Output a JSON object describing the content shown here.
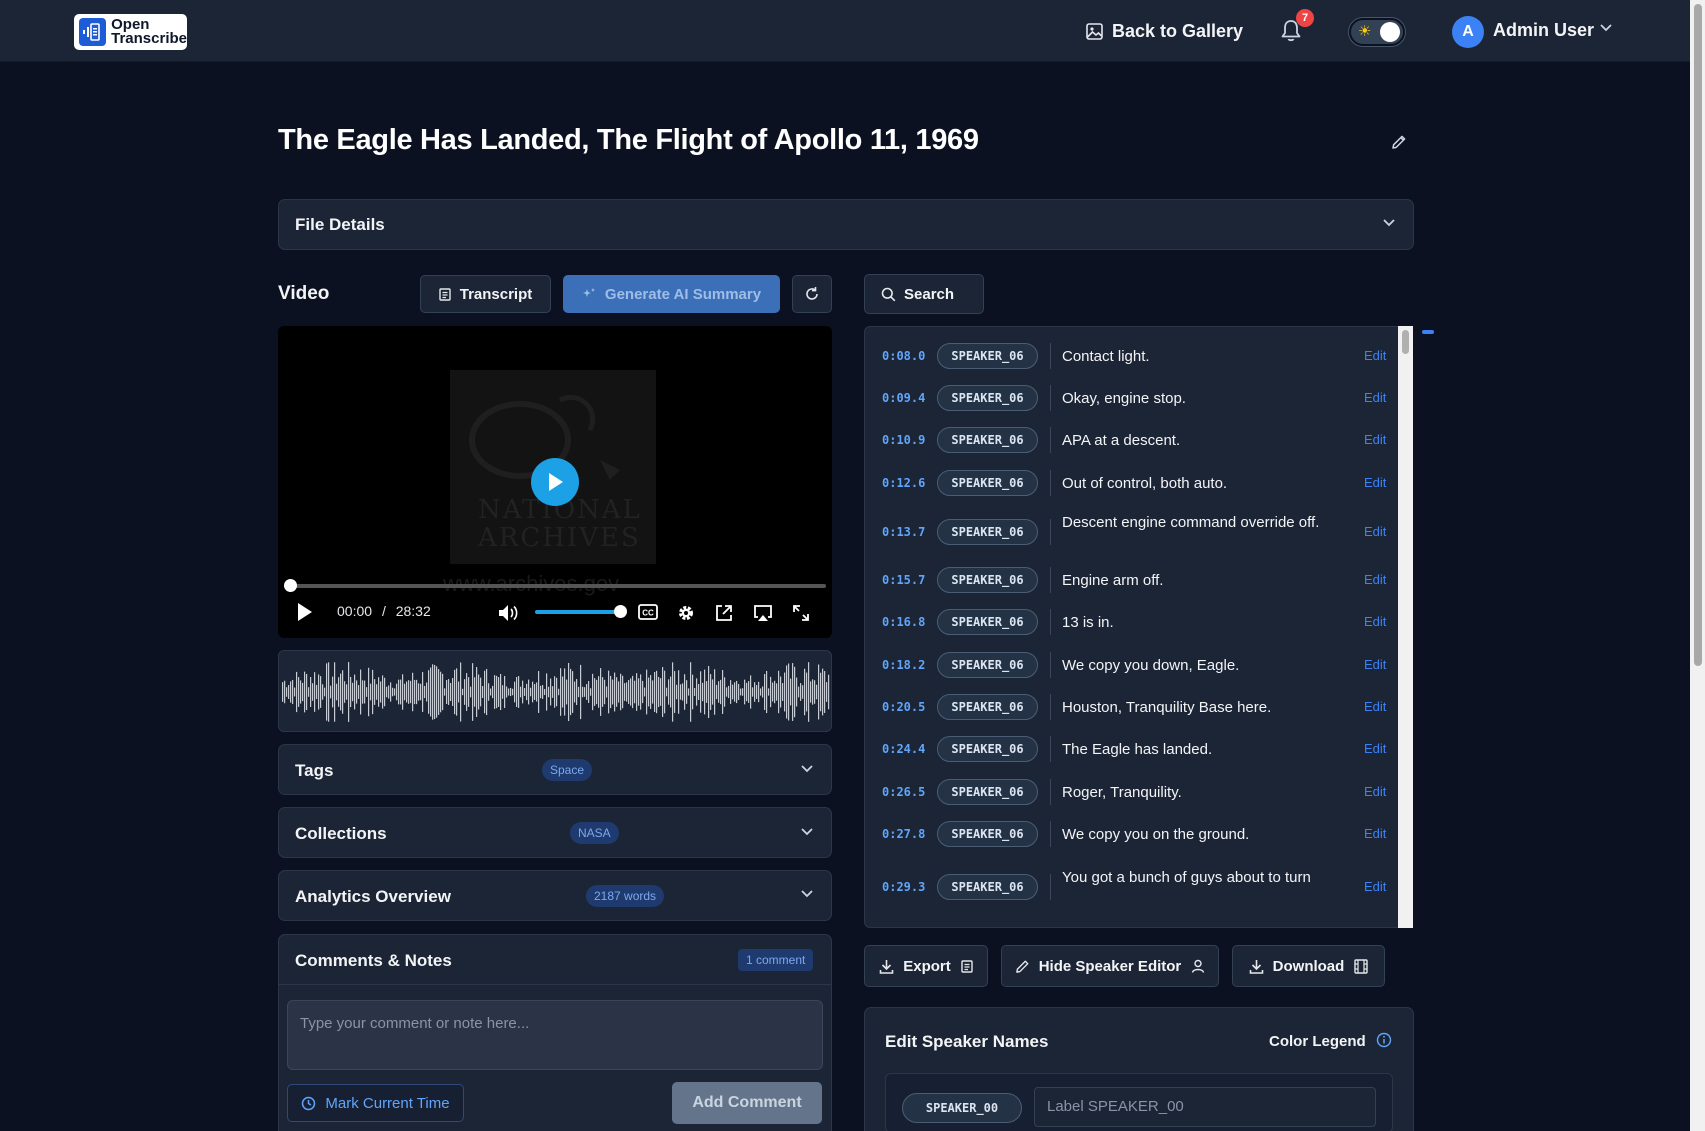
{
  "app": {
    "logo_line1": "Open",
    "logo_line2": "Transcribe"
  },
  "nav": {
    "back_label": "Back to Gallery",
    "notification_count": "7",
    "user_initial": "A",
    "user_name": "Admin User"
  },
  "page": {
    "title": "The Eagle Has Landed, The Flight of Apollo 11, 1969"
  },
  "file_details": {
    "label": "File Details"
  },
  "video": {
    "section_label": "Video",
    "current_time": "00:00",
    "separator": "/",
    "duration": "28:32",
    "volume_level": 1.0,
    "progress": 0.0
  },
  "toolbar": {
    "transcript_label": "Transcript",
    "summary_label": "Generate AI Summary",
    "search_label": "Search"
  },
  "tags": {
    "label": "Tags",
    "badge": "Space"
  },
  "collections": {
    "label": "Collections",
    "badge": "NASA"
  },
  "analytics": {
    "label": "Analytics Overview",
    "badge": "2187 words"
  },
  "comments": {
    "label": "Comments & Notes",
    "badge": "1 comment",
    "placeholder": "Type your comment or note here...",
    "mark_time_label": "Mark Current Time",
    "add_label": "Add Comment"
  },
  "transcript": {
    "edit_label": "Edit",
    "segments": [
      {
        "time": "0:08.0",
        "speaker": "SPEAKER_06",
        "text": "Contact light."
      },
      {
        "time": "0:09.4",
        "speaker": "SPEAKER_06",
        "text": "Okay, engine stop."
      },
      {
        "time": "0:10.9",
        "speaker": "SPEAKER_06",
        "text": "APA at a descent."
      },
      {
        "time": "0:12.6",
        "speaker": "SPEAKER_06",
        "text": "Out of control, both auto."
      },
      {
        "time": "0:13.7",
        "speaker": "SPEAKER_06",
        "text": "Descent engine command override off."
      },
      {
        "time": "0:15.7",
        "speaker": "SPEAKER_06",
        "text": "Engine arm off."
      },
      {
        "time": "0:16.8",
        "speaker": "SPEAKER_06",
        "text": "13 is in."
      },
      {
        "time": "0:18.2",
        "speaker": "SPEAKER_06",
        "text": "We copy you down, Eagle."
      },
      {
        "time": "0:20.5",
        "speaker": "SPEAKER_06",
        "text": "Houston, Tranquility Base here."
      },
      {
        "time": "0:24.4",
        "speaker": "SPEAKER_06",
        "text": "The Eagle has landed."
      },
      {
        "time": "0:26.5",
        "speaker": "SPEAKER_06",
        "text": "Roger, Tranquility."
      },
      {
        "time": "0:27.8",
        "speaker": "SPEAKER_06",
        "text": "We copy you on the ground."
      },
      {
        "time": "0:29.3",
        "speaker": "SPEAKER_06",
        "text": "You got a bunch of guys about to turn"
      }
    ]
  },
  "actions": {
    "export_label": "Export",
    "hide_speaker_label": "Hide Speaker Editor",
    "download_label": "Download"
  },
  "speaker_editor": {
    "title": "Edit Speaker Names",
    "legend_label": "Color Legend",
    "speakers": [
      {
        "id": "SPEAKER_00",
        "placeholder": "Label SPEAKER_00"
      }
    ]
  },
  "colors": {
    "accent": "#3b82f6",
    "play": "#1da1e6",
    "badge_bg": "#1e3a6e",
    "background": "#0b1120",
    "panel": "#1c2536"
  }
}
